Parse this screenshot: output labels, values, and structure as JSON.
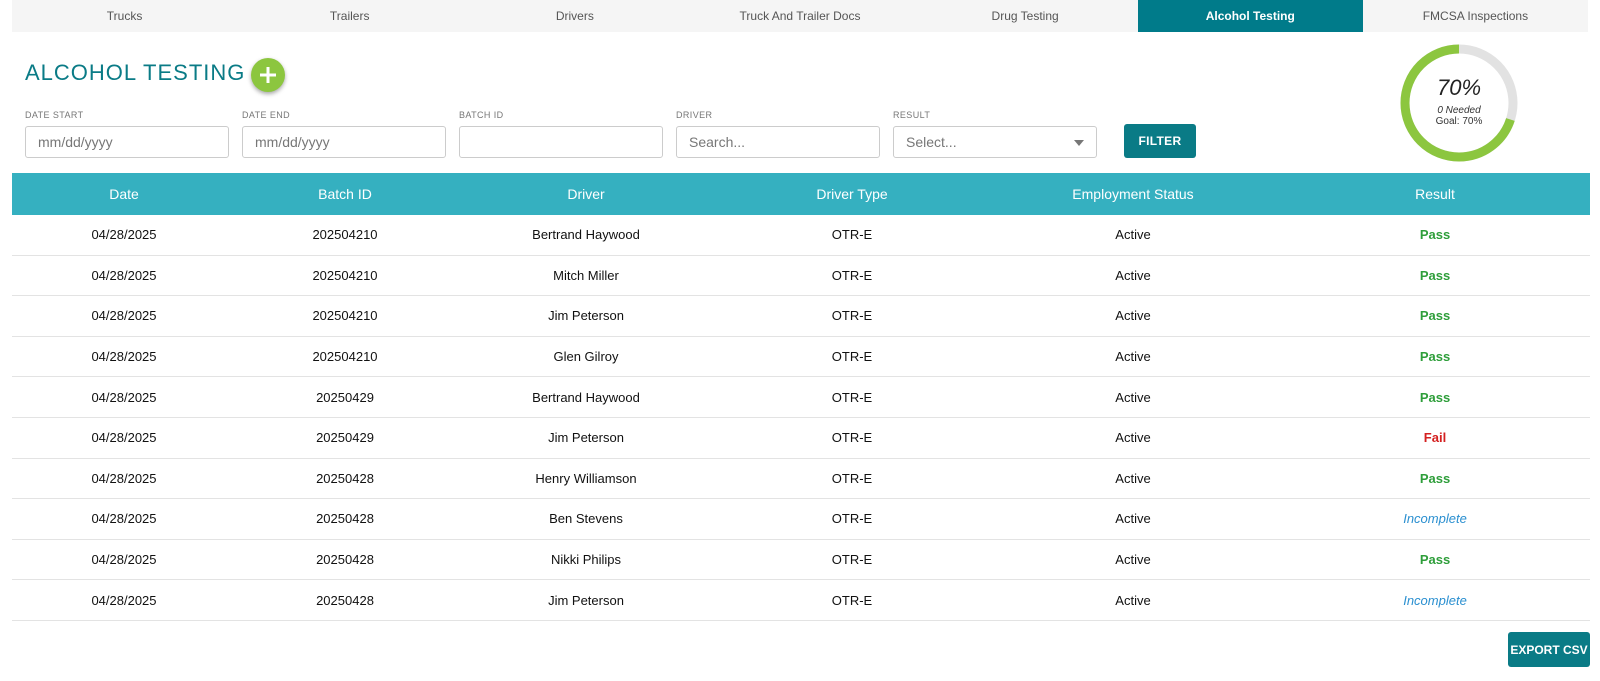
{
  "tabs": [
    {
      "label": "Trucks"
    },
    {
      "label": "Trailers"
    },
    {
      "label": "Drivers"
    },
    {
      "label": "Truck And Trailer Docs"
    },
    {
      "label": "Drug Testing"
    },
    {
      "label": "Alcohol Testing",
      "active": true
    },
    {
      "label": "FMCSA Inspections"
    }
  ],
  "header": {
    "title": "ALCOHOL TESTING"
  },
  "filters": {
    "date_start": {
      "label": "DATE START",
      "placeholder": "mm/dd/yyyy"
    },
    "date_end": {
      "label": "DATE END",
      "placeholder": "mm/dd/yyyy"
    },
    "batch_id": {
      "label": "BATCH ID",
      "placeholder": ""
    },
    "driver": {
      "label": "DRIVER",
      "placeholder": "Search..."
    },
    "result": {
      "label": "RESULT",
      "selected": "Select..."
    },
    "filter_button": "FILTER"
  },
  "gauge": {
    "percent_label": "70%",
    "needed": "0 Needed",
    "goal": "Goal: 70%",
    "fraction": 0.7,
    "color_fill": "#8cc63f",
    "color_track": "#e2e2e2"
  },
  "table": {
    "columns": [
      "Date",
      "Batch ID",
      "Driver",
      "Driver Type",
      "Employment Status",
      "Result"
    ],
    "rows": [
      [
        "04/28/2025",
        "202504210",
        "Bertrand Haywood",
        "OTR-E",
        "Active",
        "Pass"
      ],
      [
        "04/28/2025",
        "202504210",
        "Mitch Miller",
        "OTR-E",
        "Active",
        "Pass"
      ],
      [
        "04/28/2025",
        "202504210",
        "Jim Peterson",
        "OTR-E",
        "Active",
        "Pass"
      ],
      [
        "04/28/2025",
        "202504210",
        "Glen Gilroy",
        "OTR-E",
        "Active",
        "Pass"
      ],
      [
        "04/28/2025",
        "20250429",
        "Bertrand Haywood",
        "OTR-E",
        "Active",
        "Pass"
      ],
      [
        "04/28/2025",
        "20250429",
        "Jim Peterson",
        "OTR-E",
        "Active",
        "Fail"
      ],
      [
        "04/28/2025",
        "20250428",
        "Henry Williamson",
        "OTR-E",
        "Active",
        "Pass"
      ],
      [
        "04/28/2025",
        "20250428",
        "Ben Stevens",
        "OTR-E",
        "Active",
        "Incomplete"
      ],
      [
        "04/28/2025",
        "20250428",
        "Nikki Philips",
        "OTR-E",
        "Active",
        "Pass"
      ],
      [
        "04/28/2025",
        "20250428",
        "Jim Peterson",
        "OTR-E",
        "Active",
        "Incomplete"
      ]
    ]
  },
  "export_button": "EXPORT CSV",
  "colors": {
    "brand": "#0a7b86",
    "table_header": "#35b0c0",
    "add_button": "#8cc63f",
    "pass": "#2e9e3a",
    "fail": "#d42020",
    "incomplete": "#2a8fd0"
  },
  "icons": {
    "add": "plus-icon",
    "result_dropdown": "chevron-down-icon"
  }
}
